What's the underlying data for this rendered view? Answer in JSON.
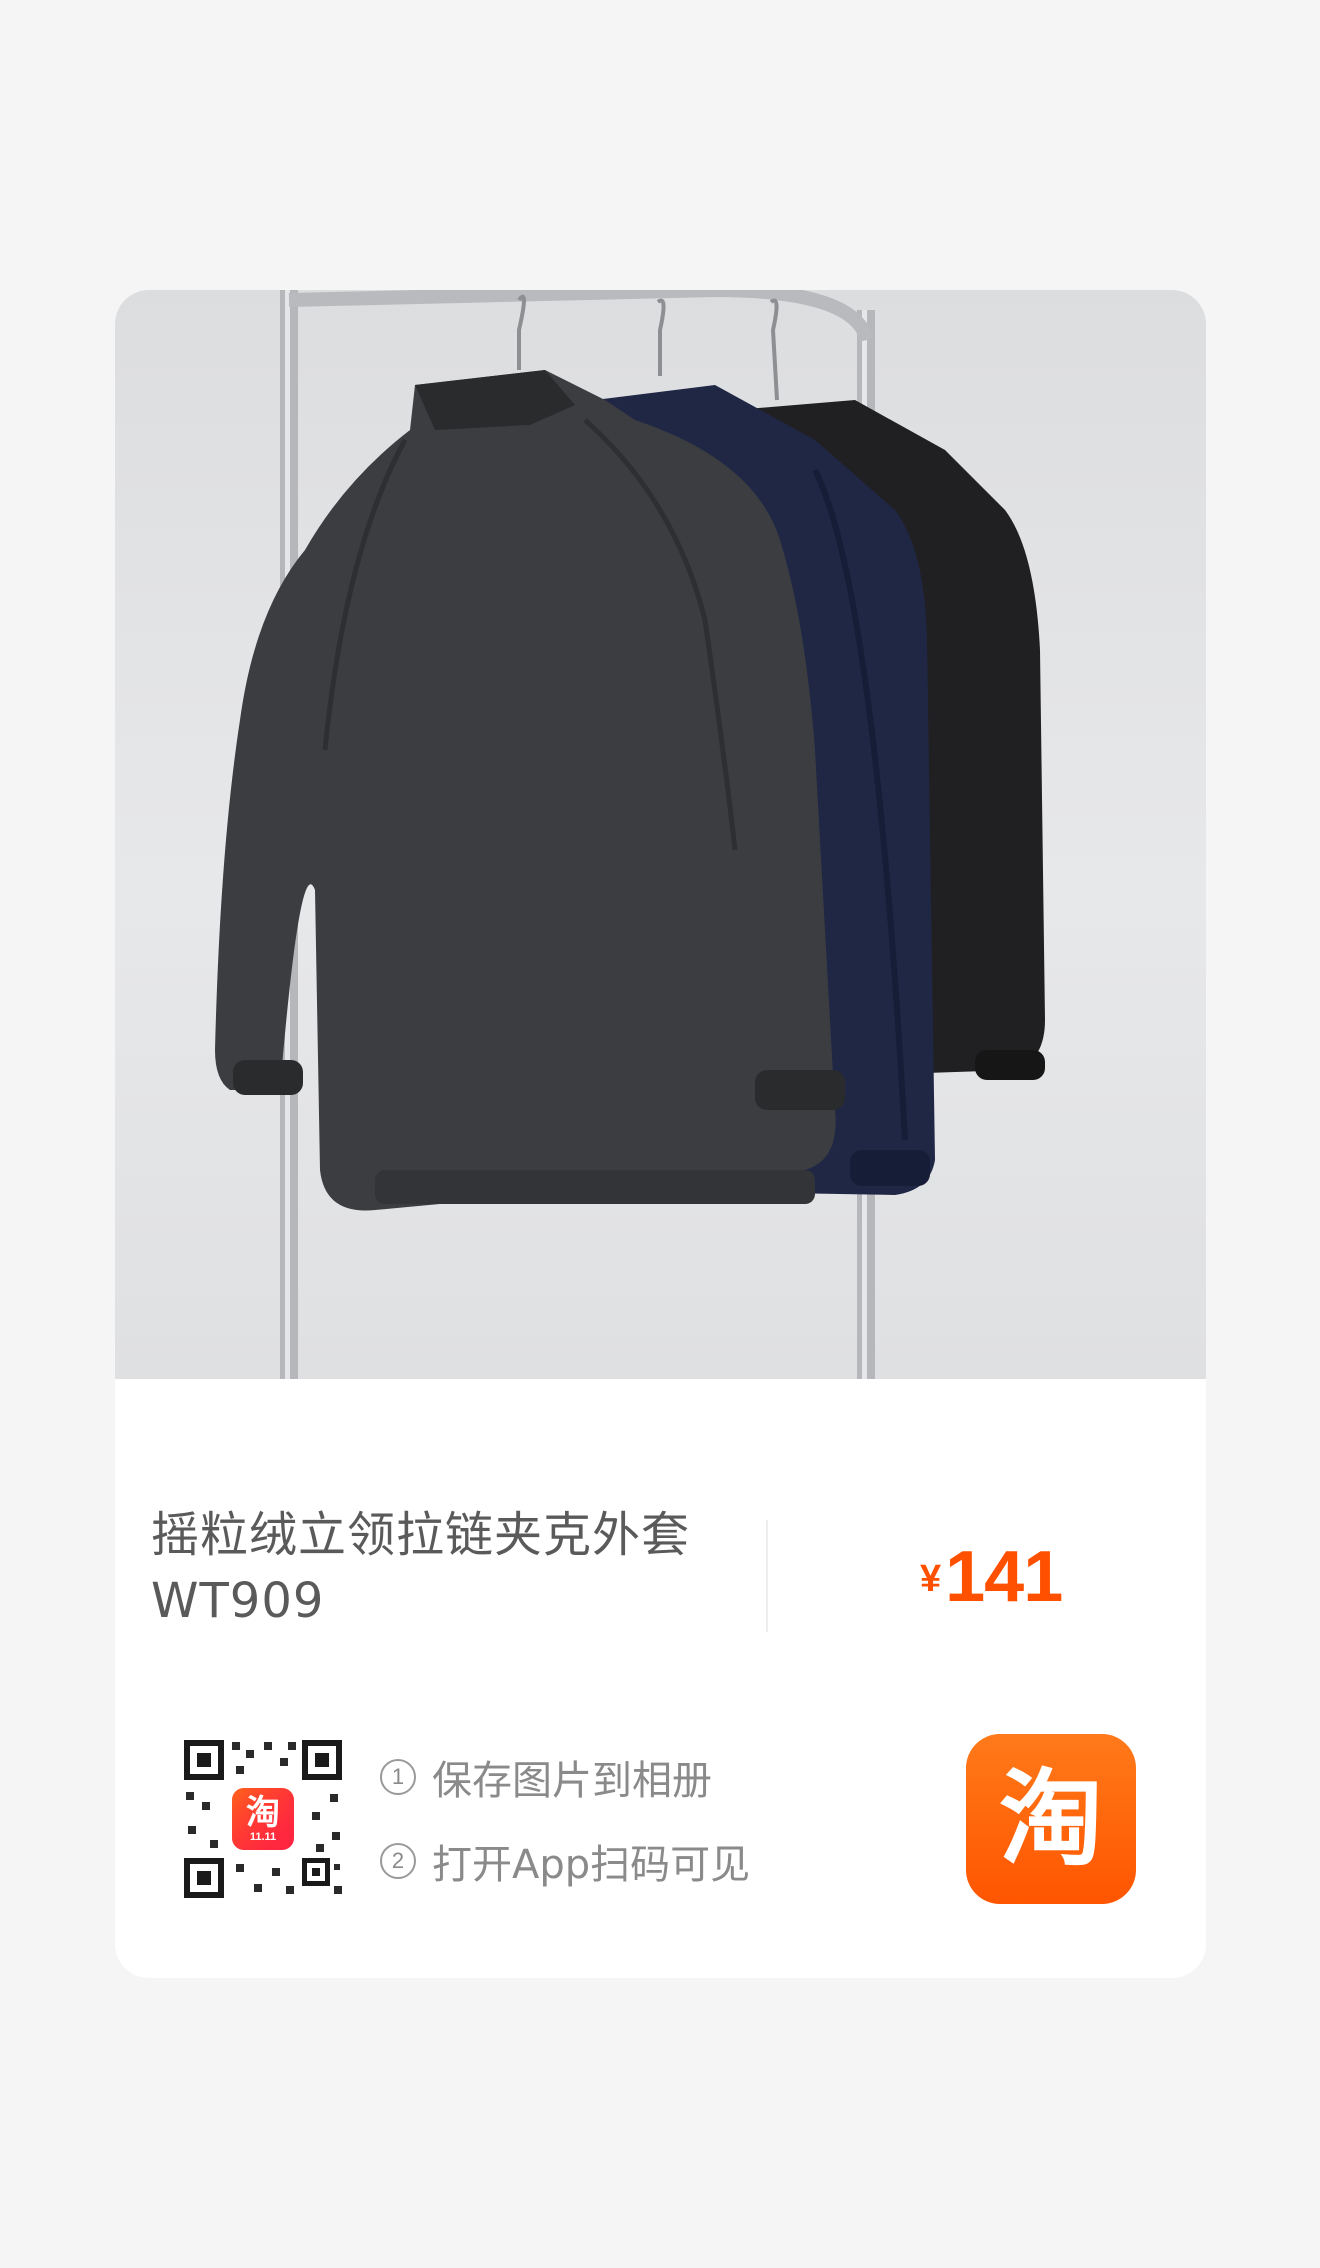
{
  "product": {
    "title_line1": "摇粒绒立领拉链夹克外套",
    "title_line2": "WT909",
    "price_currency": "¥",
    "price_value": "141"
  },
  "share": {
    "step1_number": "①",
    "step1_text": "保存图片到相册",
    "step2_number": "②",
    "step2_text": "打开App扫码可见",
    "qr_badge_text": "淘",
    "qr_badge_sub": "11.11"
  },
  "app_icon": {
    "glyph": "淘",
    "name": "taobao-icon"
  },
  "colors": {
    "accent": "#ff5000",
    "background": "#f5f5f5",
    "card": "#ffffff"
  }
}
